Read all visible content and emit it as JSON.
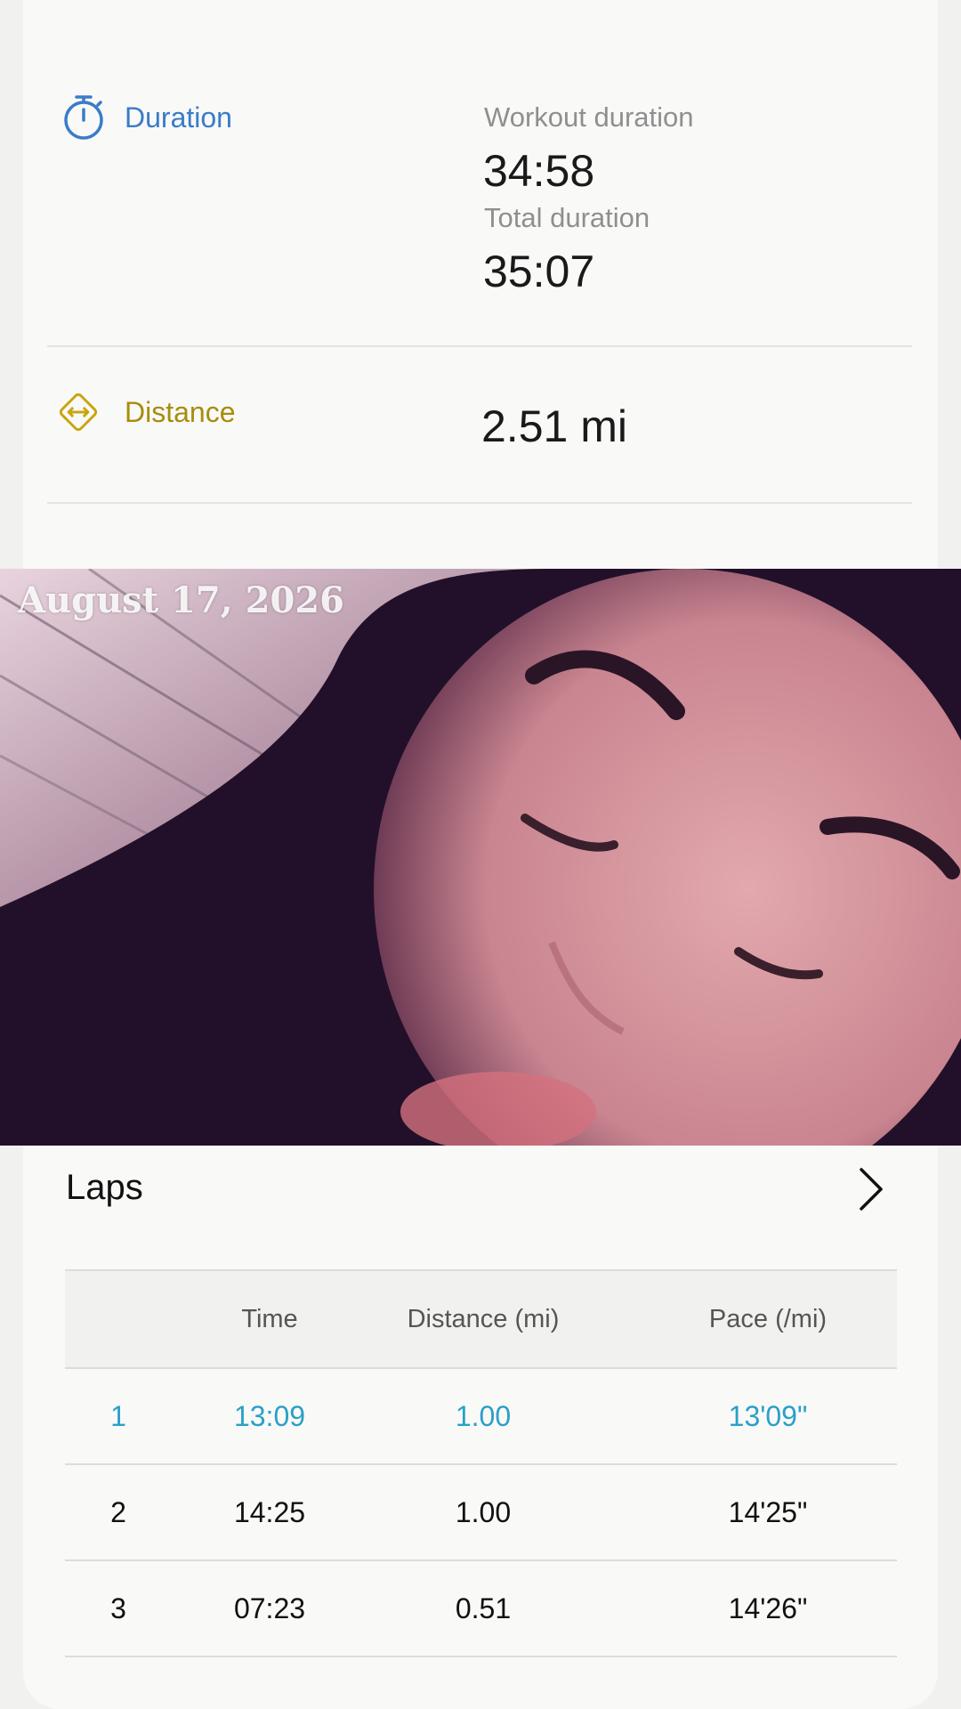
{
  "duration": {
    "label": "Duration",
    "workout_label": "Workout duration",
    "workout_value": "34:58",
    "total_label": "Total duration",
    "total_value": "35:07"
  },
  "distance": {
    "label": "Distance",
    "value": "2.51 mi"
  },
  "photo": {
    "date_overlay": "August 17, 2026"
  },
  "laps": {
    "title": "Laps",
    "columns": [
      "",
      "Time",
      "Distance (mi)",
      "Pace (/mi)"
    ],
    "rows": [
      [
        "1",
        "13:09",
        "1.00",
        "13'09\""
      ],
      [
        "2",
        "14:25",
        "1.00",
        "14'25\""
      ],
      [
        "3",
        "07:23",
        "0.51",
        "14'26\""
      ]
    ]
  },
  "colors": {
    "duration_accent": "#3a7cc7",
    "distance_accent": "#a68d0c",
    "highlight_lap": "#2aa0c8"
  },
  "icons": {
    "duration": "stopwatch-icon",
    "distance": "distance-diamond-icon",
    "laps_more": "chevron-right-icon"
  }
}
